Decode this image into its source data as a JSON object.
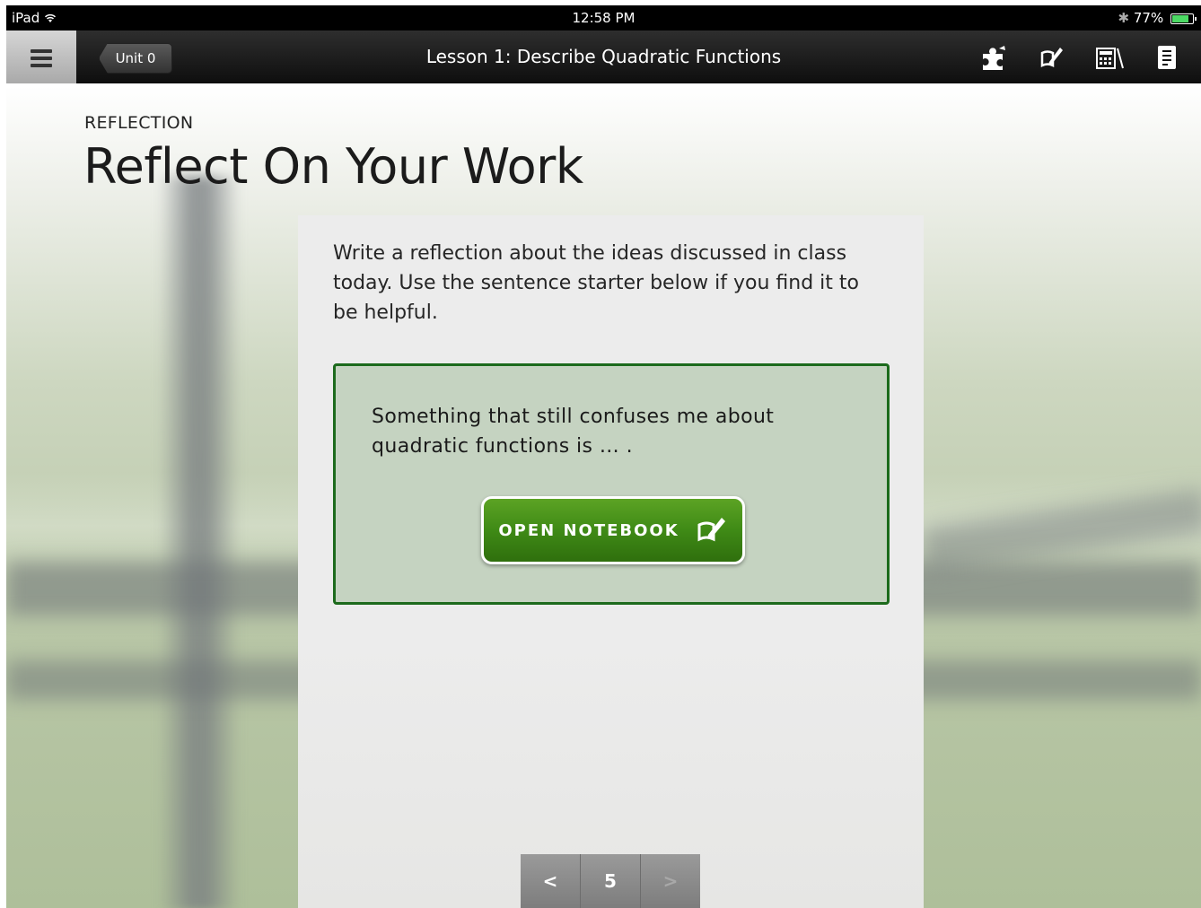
{
  "status_bar": {
    "device": "iPad",
    "time": "12:58 PM",
    "battery": "77%"
  },
  "navbar": {
    "back_label": "Unit 0",
    "title": "Lesson 1: Describe Quadratic Functions",
    "icons": [
      "menu-icon",
      "puzzle-icon",
      "notebook-pencil-icon",
      "calculator-icon",
      "document-list-icon"
    ]
  },
  "header": {
    "section_label": "REFLECTION",
    "title": "Reflect On Your Work"
  },
  "content": {
    "instructions": "Write a reflection about the ideas discussed in class today. Use the sentence starter below if you find it to be helpful.",
    "prompt": "Something that still confuses me about quadratic functions is … .",
    "button_label": "OPEN NOTEBOOK"
  },
  "pager": {
    "prev": "<",
    "page": "5",
    "next": ">"
  },
  "colors": {
    "accent_green": "#3f8a16",
    "prompt_border": "#1c6a1c",
    "prompt_bg": "#c5d3c1"
  }
}
